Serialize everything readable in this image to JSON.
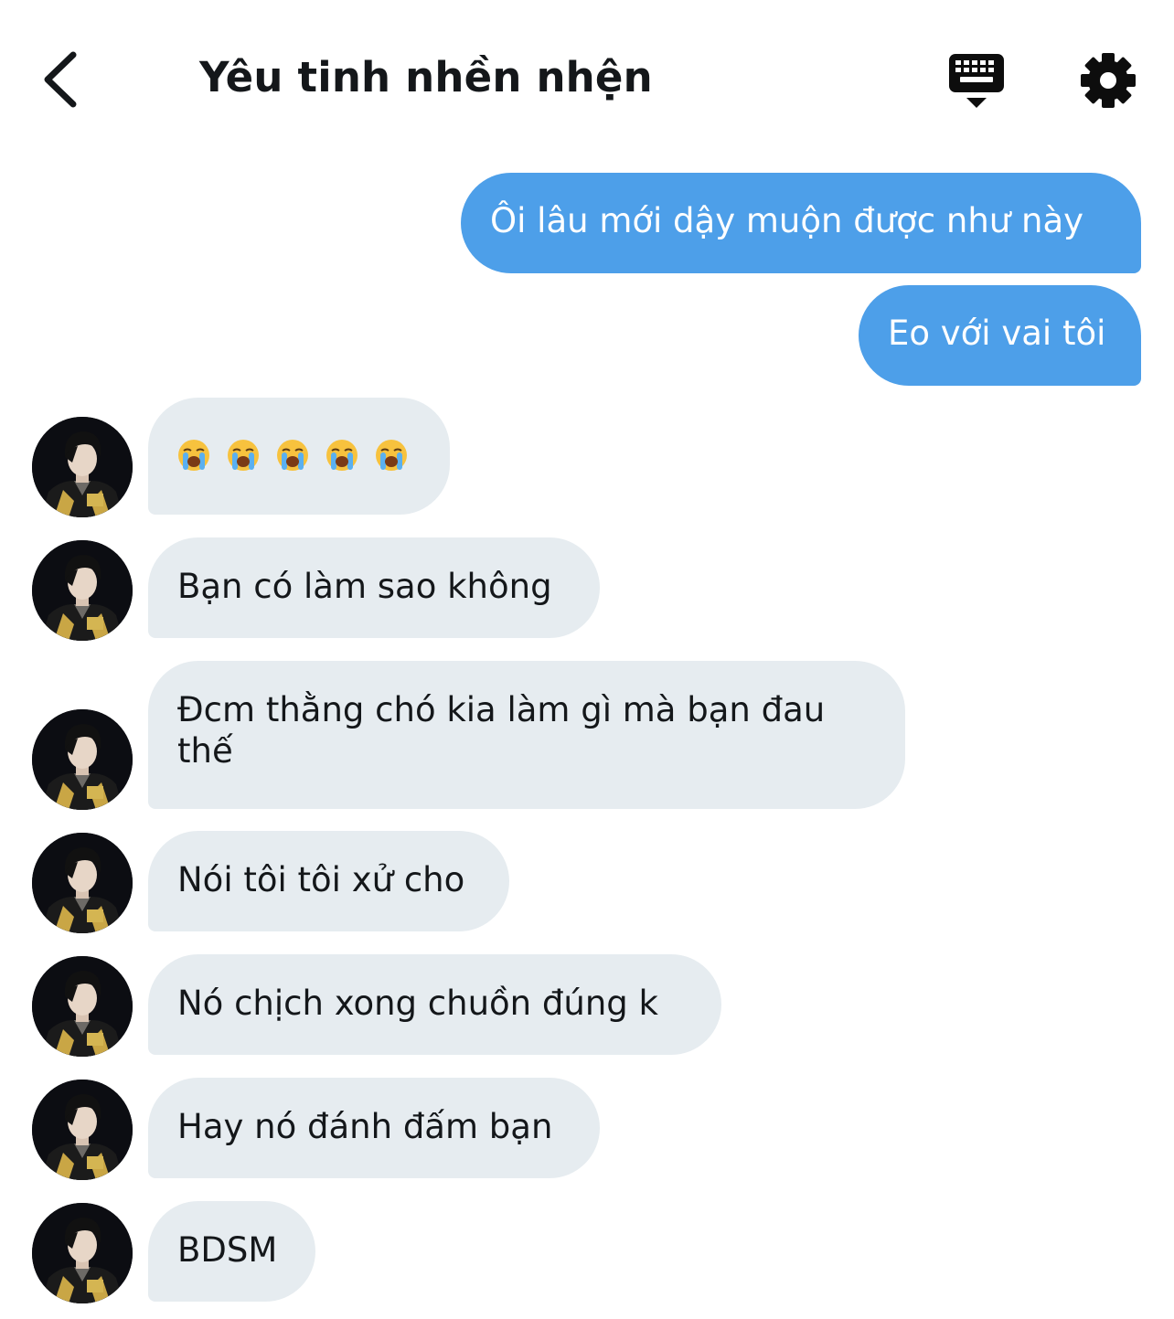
{
  "header": {
    "title": "Yêu tinh nhền nhện",
    "back_icon": "chevron-left-icon",
    "keyboard_icon": "keyboard-icon",
    "settings_icon": "gear-icon"
  },
  "colors": {
    "sent_bubble": "#4d9fe9",
    "received_bubble": "#e6ecf0",
    "text": "#14171a"
  },
  "messages": [
    {
      "direction": "sent",
      "text": "Ôi lâu mới dậy muộn được như này"
    },
    {
      "direction": "sent",
      "text": "Eo với vai tôi"
    },
    {
      "direction": "received",
      "emoji": "loudly-crying-face",
      "emoji_count": 5
    },
    {
      "direction": "received",
      "text": "Bạn có làm sao không"
    },
    {
      "direction": "received",
      "text": "Đcm thằng chó kia làm gì mà bạn đau thế"
    },
    {
      "direction": "received",
      "text": "Nói tôi tôi xử cho"
    },
    {
      "direction": "received",
      "text": "Nó chịch xong chuồn đúng k"
    },
    {
      "direction": "received",
      "text": "Hay nó đánh đấm bạn"
    },
    {
      "direction": "received",
      "text": "BDSM"
    }
  ]
}
